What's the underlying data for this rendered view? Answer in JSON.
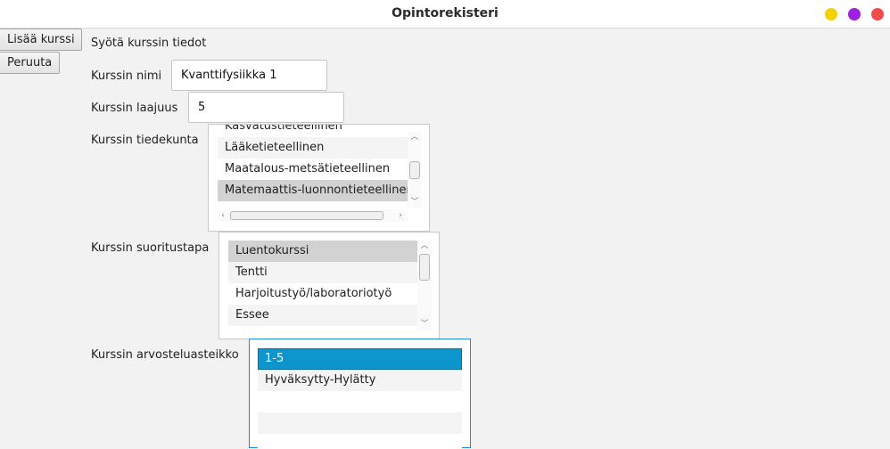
{
  "window": {
    "title": "Opintorekisteri",
    "controls": {
      "minimize_color": "#f5d000",
      "maximize_color": "#a020e0",
      "close_color": "#f24b4b"
    }
  },
  "toolbar": {
    "add_course": "Lisää kurssi",
    "cancel": "Peruuta"
  },
  "form": {
    "heading": "Syötä kurssin tiedot",
    "name_label": "Kurssin nimi",
    "name_value": "Kvanttifysiikka 1",
    "credits_label": "Kurssin laajuus",
    "credits_value": "5",
    "faculty_label": "Kurssin tiedekunta",
    "faculty_items": [
      "Kasvatustieteellinen",
      "Lääketieteellinen",
      "Maatalous-metsätieteellinen",
      "Matemaattis-luonnontieteellinen"
    ],
    "faculty_selected": "Matemaattis-luonnontieteellinen",
    "method_label": "Kurssin suoritustapa",
    "method_items": [
      "Luentokurssi",
      "Tentti",
      "Harjoitustyö/laboratoriotyö",
      "Essee"
    ],
    "method_selected": "Luentokurssi",
    "grading_label": "Kurssin arvosteluasteikko",
    "grading_items": [
      "1-5",
      "Hyväksytty-Hylätty"
    ],
    "grading_selected": "1-5"
  },
  "icons": {
    "scroll_up": "chevron-up-icon",
    "scroll_down": "chevron-down-icon",
    "scroll_left": "chevron-left-icon",
    "scroll_right": "chevron-right-icon"
  }
}
